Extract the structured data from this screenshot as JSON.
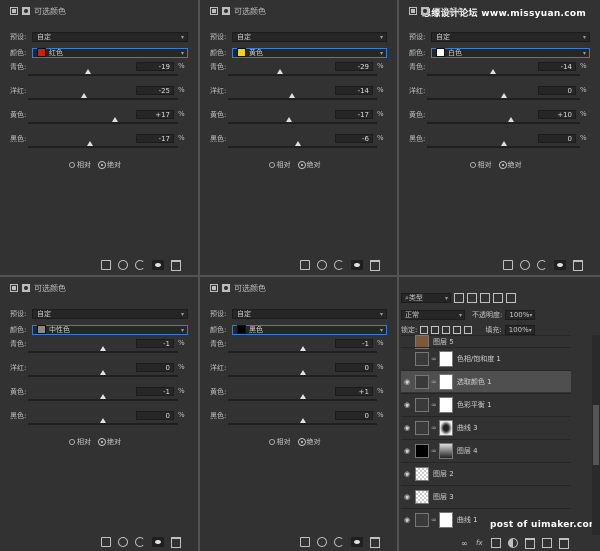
{
  "watermark_top": "思缘设计论坛 www.missyuan.com",
  "watermark_bottom": "post of uimaker.com",
  "labels": {
    "title": "可选颜色",
    "preset": "预设:",
    "preset_value": "自定",
    "color": "颜色:",
    "cyan": "青色:",
    "magenta": "洋红:",
    "yellow": "黄色:",
    "black": "黑色:",
    "pct": "%",
    "relative": "相对",
    "absolute": "绝对"
  },
  "panels": [
    {
      "color_name": "红色",
      "swatch": "#c0251a",
      "values": [
        "-19",
        "-25",
        "+17",
        "-17"
      ],
      "knobs": [
        0.4,
        0.37,
        0.58,
        0.41
      ]
    },
    {
      "color_name": "黄色",
      "swatch": "#f2d51c",
      "values": [
        "-29",
        "-14",
        "-17",
        "-6"
      ],
      "knobs": [
        0.35,
        0.43,
        0.41,
        0.47
      ]
    },
    {
      "color_name": "白色",
      "swatch": "#ffffff",
      "values": [
        "-14",
        "0",
        "+10",
        "0"
      ],
      "knobs": [
        0.43,
        0.5,
        0.55,
        0.5
      ]
    },
    {
      "color_name": "中性色",
      "swatch": "#8a8a8a",
      "values": [
        "-1",
        "0",
        "-1",
        "0"
      ],
      "knobs": [
        0.5,
        0.5,
        0.5,
        0.5
      ]
    },
    {
      "color_name": "黑色",
      "swatch": "#000000",
      "values": [
        "-1",
        "0",
        "+1",
        "0"
      ],
      "knobs": [
        0.5,
        0.5,
        0.5,
        0.5
      ]
    }
  ],
  "layers_panel": {
    "kind_filter": "类型",
    "blend_mode": "正常",
    "opacity_label": "不透明度:",
    "opacity_value": "100%",
    "lock_label": "锁定:",
    "fill_label": "填充:",
    "fill_value": "100%",
    "layers": [
      {
        "name": "图层 5",
        "visible": false,
        "thumb": "#7a5a3a",
        "mask": false,
        "selected": false
      },
      {
        "name": "色相/饱和度 1",
        "visible": false,
        "thumb": "adj",
        "mask": true,
        "selected": false
      },
      {
        "name": "选取颜色 1",
        "visible": true,
        "thumb": "adj",
        "mask": true,
        "selected": true
      },
      {
        "name": "色彩平衡 1",
        "visible": true,
        "thumb": "adj",
        "mask": true,
        "selected": false
      },
      {
        "name": "曲线 3",
        "visible": true,
        "thumb": "adj",
        "mask": true,
        "selected": false
      },
      {
        "name": "图层 4",
        "visible": true,
        "thumb": "#000000",
        "mask": true,
        "selected": false
      },
      {
        "name": "图层 2",
        "visible": true,
        "thumb": "checker",
        "mask": false,
        "selected": false
      },
      {
        "name": "图层 3",
        "visible": true,
        "thumb": "checker",
        "mask": false,
        "selected": false
      },
      {
        "name": "曲线 1",
        "visible": true,
        "thumb": "adj",
        "mask": true,
        "selected": false
      }
    ]
  }
}
